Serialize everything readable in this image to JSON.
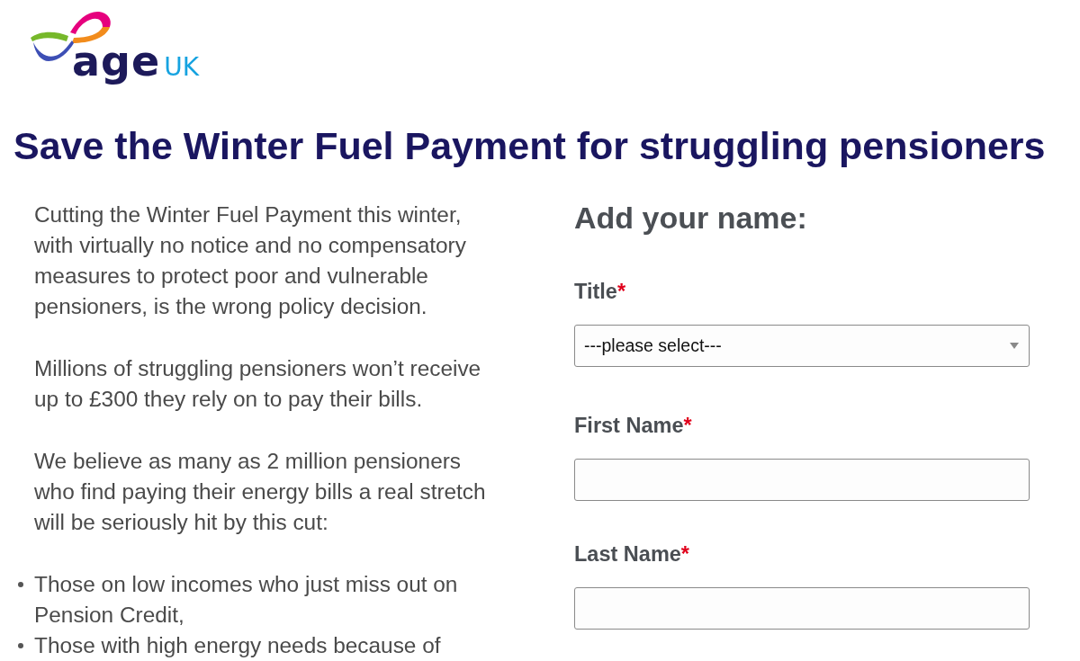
{
  "logo": {
    "wordmark": "age",
    "suffix": "UK"
  },
  "heading": "Save the Winter Fuel Payment for struggling pensioners",
  "intro": {
    "paragraphs": [
      "Cutting the Winter Fuel Payment this winter, with virtually no notice and no compensatory measures to protect poor and vulnerable pensioners, is the wrong policy decision.",
      "Millions of struggling pensioners won’t receive up to £300 they rely on to pay their bills.",
      "We believe as many as 2 million pensioners who find paying their energy bills a real stretch will be seriously hit by this cut:"
    ],
    "bullets": [
      "Those on low incomes who just miss out on Pension Credit,",
      "Those with high energy needs because of"
    ]
  },
  "form": {
    "title": "Add your name:",
    "fields": [
      {
        "kind": "select",
        "label": "Title",
        "required_mark": "*",
        "value": "---please select---"
      },
      {
        "kind": "text",
        "label": "First Name",
        "required_mark": "*"
      },
      {
        "kind": "text",
        "label": "Last Name",
        "required_mark": "*"
      }
    ]
  }
}
